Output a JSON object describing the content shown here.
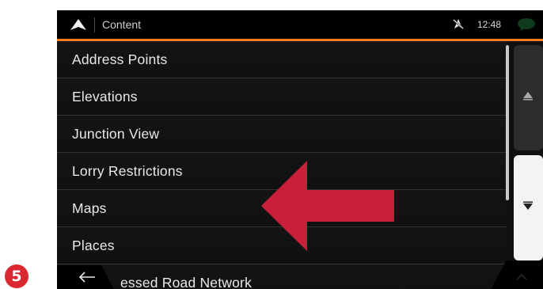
{
  "step": {
    "number": "5"
  },
  "header": {
    "title": "Content",
    "time": "12:48",
    "icons": {
      "navigation": "navigation-arrow-icon",
      "gps": "gps-off-icon",
      "messages": "message-bubble-icon"
    }
  },
  "list": {
    "items": [
      {
        "label": "Address Points"
      },
      {
        "label": "Elevations"
      },
      {
        "label": "Junction View"
      },
      {
        "label": "Lorry Restrictions"
      },
      {
        "label": "Maps"
      },
      {
        "label": "Places"
      },
      {
        "label": "essed Road Network"
      }
    ]
  },
  "scroll": {
    "up_icon": "triangle-up-icon",
    "down_icon": "triangle-down-icon"
  },
  "footer": {
    "back_icon": "back-arrow-icon"
  },
  "annotation": {
    "arrow_color": "#c8203a",
    "points_to": "Maps"
  },
  "colors": {
    "accent": "#f07c22",
    "badge": "#d9282f",
    "background": "#101011"
  }
}
